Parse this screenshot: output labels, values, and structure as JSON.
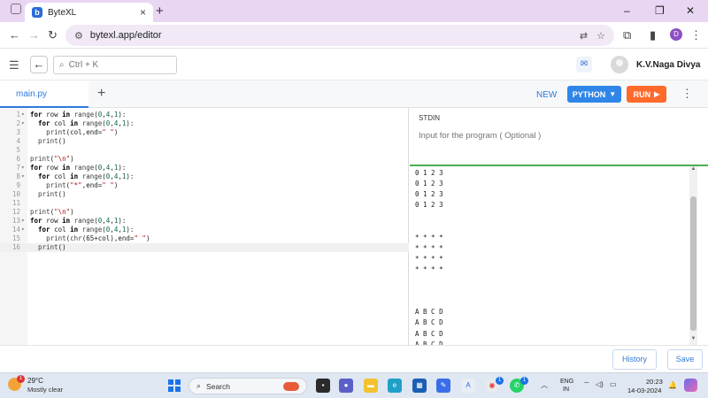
{
  "browser": {
    "tab_title": "ByteXL",
    "tab_favicon": "b",
    "url": "bytexl.app/editor",
    "profile_initial": "D"
  },
  "header": {
    "search_placeholder": "Ctrl + K",
    "user_name": "K.V.Naga Divya"
  },
  "toolbar": {
    "file_name": "main.py",
    "new_label": "NEW",
    "language_label": "PYTHON",
    "run_label": "RUN"
  },
  "editor": {
    "lines": [
      {
        "n": "1",
        "fold": true,
        "code": "for row in range(0,4,1):"
      },
      {
        "n": "2",
        "fold": true,
        "code": "  for col in range(0,4,1):"
      },
      {
        "n": "3",
        "fold": false,
        "code": "    print(col,end=\" \")"
      },
      {
        "n": "4",
        "fold": false,
        "code": "  print()"
      },
      {
        "n": "5",
        "fold": false,
        "code": ""
      },
      {
        "n": "6",
        "fold": false,
        "code": "print(\"\\n\")"
      },
      {
        "n": "7",
        "fold": true,
        "code": "for row in range(0,4,1):"
      },
      {
        "n": "8",
        "fold": true,
        "code": "  for col in range(0,4,1):"
      },
      {
        "n": "9",
        "fold": false,
        "code": "    print(\"*\",end=\" \")"
      },
      {
        "n": "10",
        "fold": false,
        "code": "  print()"
      },
      {
        "n": "11",
        "fold": false,
        "code": ""
      },
      {
        "n": "12",
        "fold": false,
        "code": "print(\"\\n\")"
      },
      {
        "n": "13",
        "fold": true,
        "code": "for row in range(0,4,1):"
      },
      {
        "n": "14",
        "fold": true,
        "code": "  for col in range(0,4,1):"
      },
      {
        "n": "15",
        "fold": false,
        "code": "    print(chr(65+col),end=\" \")"
      },
      {
        "n": "16",
        "fold": false,
        "code": "  print()"
      }
    ],
    "active_line": "16"
  },
  "stdin": {
    "label": "STDIN",
    "placeholder": "Input for the program ( Optional )"
  },
  "output": {
    "lines": [
      "0 1 2 3",
      "0 1 2 3",
      "0 1 2 3",
      "0 1 2 3",
      "",
      "",
      "* * * *",
      "* * * *",
      "* * * *",
      "* * * *",
      "",
      "",
      "",
      "A B C D",
      "A B C D",
      "A B C D",
      "A B C D"
    ]
  },
  "footer": {
    "history_label": "History",
    "save_label": "Save"
  },
  "taskbar": {
    "weather_badge": "1",
    "weather_temp": "29°C",
    "weather_desc": "Mostly clear",
    "search_label": "Search",
    "whatsapp_badge": "1",
    "chrome_badge": "1",
    "lang_line1": "ENG",
    "lang_line2": "IN",
    "time": "20:23",
    "date": "14-03-2024"
  },
  "colors": {
    "accent_blue": "#2f7ad9",
    "run_orange": "#ff6a2b",
    "language_blue": "#2f86e8",
    "stdin_border_green": "#4caf50",
    "tabstrip_bg": "#e8d6f3"
  }
}
